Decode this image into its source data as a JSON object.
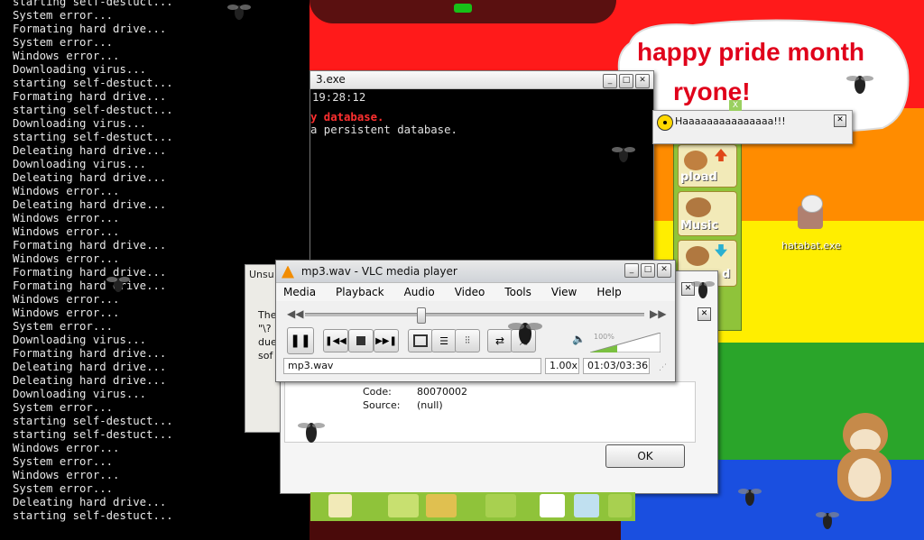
{
  "console_left": {
    "lines": [
      "starting self-destuct...",
      "System error...",
      "Formating hard drive...",
      "System error...",
      "Windows error...",
      "Downloading virus...",
      "starting self-destuct...",
      "Formating hard drive...",
      "starting self-destuct...",
      "Downloading virus...",
      "starting self-destuct...",
      "Deleating hard drive...",
      "Downloading virus...",
      "Deleating hard drive...",
      "Windows error...",
      "Deleating hard drive...",
      "Windows error...",
      "Windows error...",
      "Formating hard drive...",
      "Windows error...",
      "Formating hard drive...",
      "Formating hard drive...",
      "Windows error...",
      "Windows error...",
      "System error...",
      "Downloading virus...",
      "Formating hard drive...",
      "Deleating hard drive...",
      "Deleating hard drive...",
      "Downloading virus...",
      "System error...",
      "starting self-destuct...",
      "starting self-destuct...",
      "Windows error...",
      "System error...",
      "Windows error...",
      "System error...",
      "Deleating hard drive...",
      "starting self-destuct..."
    ]
  },
  "cmd_mid": {
    "title": "3.exe",
    "lines": [
      "19:28:12",
      "y database.",
      "a persistent database."
    ]
  },
  "bubble": {
    "line1": "happy pride month",
    "line2": "ryone!"
  },
  "popup": {
    "text": "Haaaaaaaaaaaaaaa!!!"
  },
  "green_panel": {
    "labels": [
      "pload",
      "Music",
      "d"
    ]
  },
  "desktop_icon": {
    "label": "hatabat.exe"
  },
  "vlc": {
    "title": "mp3.wav - VLC media player",
    "menu": [
      "Media",
      "Playback",
      "Audio",
      "Video",
      "Tools",
      "View",
      "Help"
    ],
    "filename": "mp3.wav",
    "speed": "1.00x",
    "time": "01:03/03:36",
    "volume": "100%",
    "seek_fraction": 0.33
  },
  "unsu": {
    "title": "Unsu",
    "lines": [
      "The",
      "\"\\?",
      "due",
      "sof"
    ]
  },
  "error_dialog": {
    "code_label": "Code:",
    "code_value": "80070002",
    "source_label": "Source:",
    "source_value": "(null)",
    "ok_label": "OK"
  },
  "colors": {
    "rainbow": [
      "#ff1a1a",
      "#ff8c00",
      "#ffee00",
      "#2aa52a",
      "#1a4fe0",
      "#8b1aa8"
    ],
    "bubble_text": "#e0001a"
  }
}
